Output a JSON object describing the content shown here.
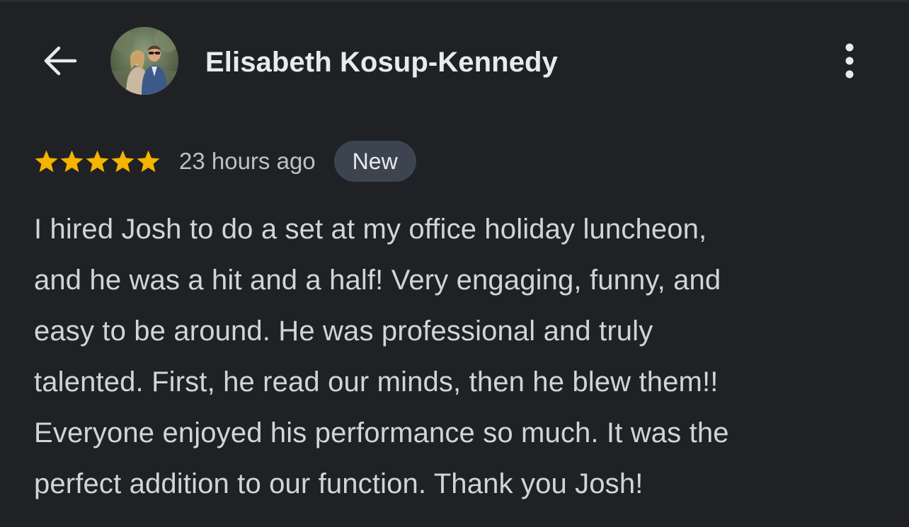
{
  "header": {
    "back_icon": "arrow-back-icon",
    "reviewer_name": "Elisabeth Kosup-Kennedy",
    "avatar_icon": "reviewer-avatar-photo",
    "more_icon": "more-vertical-icon"
  },
  "review": {
    "rating": 5,
    "rating_max": 5,
    "star_color": "#f4b400",
    "time_ago": "23 hours ago",
    "badge_label": "New",
    "lines": [
      "I hired Josh to do a set at my office holiday luncheon,",
      "and he was a hit and a half! Very engaging, funny, and",
      "easy to be around. He was professional and truly",
      "talented. First, he read our minds, then he blew them!!",
      "Everyone enjoyed his performance so much. It was the",
      "perfect addition to our function. Thank you Josh!"
    ]
  },
  "colors": {
    "background": "#202124",
    "text_primary": "#e8eaed",
    "text_secondary": "#bdc1c6",
    "badge_background": "#3c4450"
  }
}
